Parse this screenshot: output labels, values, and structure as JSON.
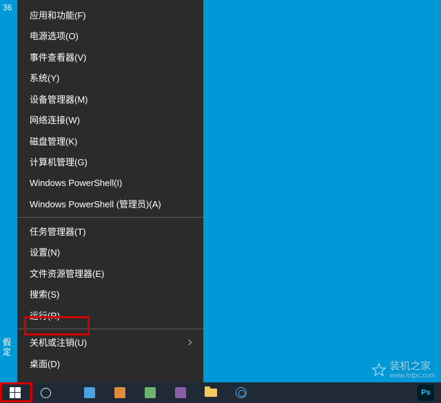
{
  "desktop": {
    "partial_icon_text_1": "假",
    "partial_icon_text_2": "定",
    "partial_top_text": "36"
  },
  "menu": {
    "group1": [
      "应用和功能(F)",
      "电源选项(O)",
      "事件查看器(V)",
      "系统(Y)",
      "设备管理器(M)",
      "网络连接(W)",
      "磁盘管理(K)",
      "计算机管理(G)",
      "Windows PowerShell(I)",
      "Windows PowerShell (管理员)(A)"
    ],
    "group2": [
      "任务管理器(T)",
      "设置(N)",
      "文件资源管理器(E)",
      "搜索(S)",
      "运行(R)"
    ],
    "group3_submenu": "关机或注销(U)",
    "group3_last": "桌面(D)"
  },
  "taskbar": {
    "ps_label": "Ps"
  },
  "watermark": {
    "text": "装机之家",
    "url": "www.lotpc.com"
  }
}
